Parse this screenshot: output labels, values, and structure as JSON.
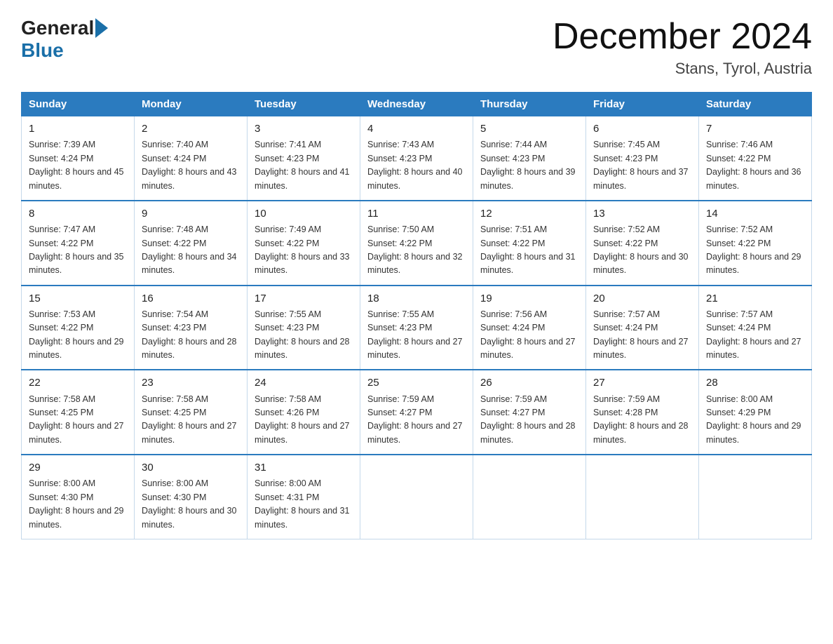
{
  "logo": {
    "text_general": "General",
    "text_blue": "Blue"
  },
  "title": "December 2024",
  "location": "Stans, Tyrol, Austria",
  "days_of_week": [
    "Sunday",
    "Monday",
    "Tuesday",
    "Wednesday",
    "Thursday",
    "Friday",
    "Saturday"
  ],
  "weeks": [
    [
      {
        "day": "1",
        "sunrise": "Sunrise: 7:39 AM",
        "sunset": "Sunset: 4:24 PM",
        "daylight": "Daylight: 8 hours and 45 minutes."
      },
      {
        "day": "2",
        "sunrise": "Sunrise: 7:40 AM",
        "sunset": "Sunset: 4:24 PM",
        "daylight": "Daylight: 8 hours and 43 minutes."
      },
      {
        "day": "3",
        "sunrise": "Sunrise: 7:41 AM",
        "sunset": "Sunset: 4:23 PM",
        "daylight": "Daylight: 8 hours and 41 minutes."
      },
      {
        "day": "4",
        "sunrise": "Sunrise: 7:43 AM",
        "sunset": "Sunset: 4:23 PM",
        "daylight": "Daylight: 8 hours and 40 minutes."
      },
      {
        "day": "5",
        "sunrise": "Sunrise: 7:44 AM",
        "sunset": "Sunset: 4:23 PM",
        "daylight": "Daylight: 8 hours and 39 minutes."
      },
      {
        "day": "6",
        "sunrise": "Sunrise: 7:45 AM",
        "sunset": "Sunset: 4:23 PM",
        "daylight": "Daylight: 8 hours and 37 minutes."
      },
      {
        "day": "7",
        "sunrise": "Sunrise: 7:46 AM",
        "sunset": "Sunset: 4:22 PM",
        "daylight": "Daylight: 8 hours and 36 minutes."
      }
    ],
    [
      {
        "day": "8",
        "sunrise": "Sunrise: 7:47 AM",
        "sunset": "Sunset: 4:22 PM",
        "daylight": "Daylight: 8 hours and 35 minutes."
      },
      {
        "day": "9",
        "sunrise": "Sunrise: 7:48 AM",
        "sunset": "Sunset: 4:22 PM",
        "daylight": "Daylight: 8 hours and 34 minutes."
      },
      {
        "day": "10",
        "sunrise": "Sunrise: 7:49 AM",
        "sunset": "Sunset: 4:22 PM",
        "daylight": "Daylight: 8 hours and 33 minutes."
      },
      {
        "day": "11",
        "sunrise": "Sunrise: 7:50 AM",
        "sunset": "Sunset: 4:22 PM",
        "daylight": "Daylight: 8 hours and 32 minutes."
      },
      {
        "day": "12",
        "sunrise": "Sunrise: 7:51 AM",
        "sunset": "Sunset: 4:22 PM",
        "daylight": "Daylight: 8 hours and 31 minutes."
      },
      {
        "day": "13",
        "sunrise": "Sunrise: 7:52 AM",
        "sunset": "Sunset: 4:22 PM",
        "daylight": "Daylight: 8 hours and 30 minutes."
      },
      {
        "day": "14",
        "sunrise": "Sunrise: 7:52 AM",
        "sunset": "Sunset: 4:22 PM",
        "daylight": "Daylight: 8 hours and 29 minutes."
      }
    ],
    [
      {
        "day": "15",
        "sunrise": "Sunrise: 7:53 AM",
        "sunset": "Sunset: 4:22 PM",
        "daylight": "Daylight: 8 hours and 29 minutes."
      },
      {
        "day": "16",
        "sunrise": "Sunrise: 7:54 AM",
        "sunset": "Sunset: 4:23 PM",
        "daylight": "Daylight: 8 hours and 28 minutes."
      },
      {
        "day": "17",
        "sunrise": "Sunrise: 7:55 AM",
        "sunset": "Sunset: 4:23 PM",
        "daylight": "Daylight: 8 hours and 28 minutes."
      },
      {
        "day": "18",
        "sunrise": "Sunrise: 7:55 AM",
        "sunset": "Sunset: 4:23 PM",
        "daylight": "Daylight: 8 hours and 27 minutes."
      },
      {
        "day": "19",
        "sunrise": "Sunrise: 7:56 AM",
        "sunset": "Sunset: 4:24 PM",
        "daylight": "Daylight: 8 hours and 27 minutes."
      },
      {
        "day": "20",
        "sunrise": "Sunrise: 7:57 AM",
        "sunset": "Sunset: 4:24 PM",
        "daylight": "Daylight: 8 hours and 27 minutes."
      },
      {
        "day": "21",
        "sunrise": "Sunrise: 7:57 AM",
        "sunset": "Sunset: 4:24 PM",
        "daylight": "Daylight: 8 hours and 27 minutes."
      }
    ],
    [
      {
        "day": "22",
        "sunrise": "Sunrise: 7:58 AM",
        "sunset": "Sunset: 4:25 PM",
        "daylight": "Daylight: 8 hours and 27 minutes."
      },
      {
        "day": "23",
        "sunrise": "Sunrise: 7:58 AM",
        "sunset": "Sunset: 4:25 PM",
        "daylight": "Daylight: 8 hours and 27 minutes."
      },
      {
        "day": "24",
        "sunrise": "Sunrise: 7:58 AM",
        "sunset": "Sunset: 4:26 PM",
        "daylight": "Daylight: 8 hours and 27 minutes."
      },
      {
        "day": "25",
        "sunrise": "Sunrise: 7:59 AM",
        "sunset": "Sunset: 4:27 PM",
        "daylight": "Daylight: 8 hours and 27 minutes."
      },
      {
        "day": "26",
        "sunrise": "Sunrise: 7:59 AM",
        "sunset": "Sunset: 4:27 PM",
        "daylight": "Daylight: 8 hours and 28 minutes."
      },
      {
        "day": "27",
        "sunrise": "Sunrise: 7:59 AM",
        "sunset": "Sunset: 4:28 PM",
        "daylight": "Daylight: 8 hours and 28 minutes."
      },
      {
        "day": "28",
        "sunrise": "Sunrise: 8:00 AM",
        "sunset": "Sunset: 4:29 PM",
        "daylight": "Daylight: 8 hours and 29 minutes."
      }
    ],
    [
      {
        "day": "29",
        "sunrise": "Sunrise: 8:00 AM",
        "sunset": "Sunset: 4:30 PM",
        "daylight": "Daylight: 8 hours and 29 minutes."
      },
      {
        "day": "30",
        "sunrise": "Sunrise: 8:00 AM",
        "sunset": "Sunset: 4:30 PM",
        "daylight": "Daylight: 8 hours and 30 minutes."
      },
      {
        "day": "31",
        "sunrise": "Sunrise: 8:00 AM",
        "sunset": "Sunset: 4:31 PM",
        "daylight": "Daylight: 8 hours and 31 minutes."
      },
      null,
      null,
      null,
      null
    ]
  ]
}
